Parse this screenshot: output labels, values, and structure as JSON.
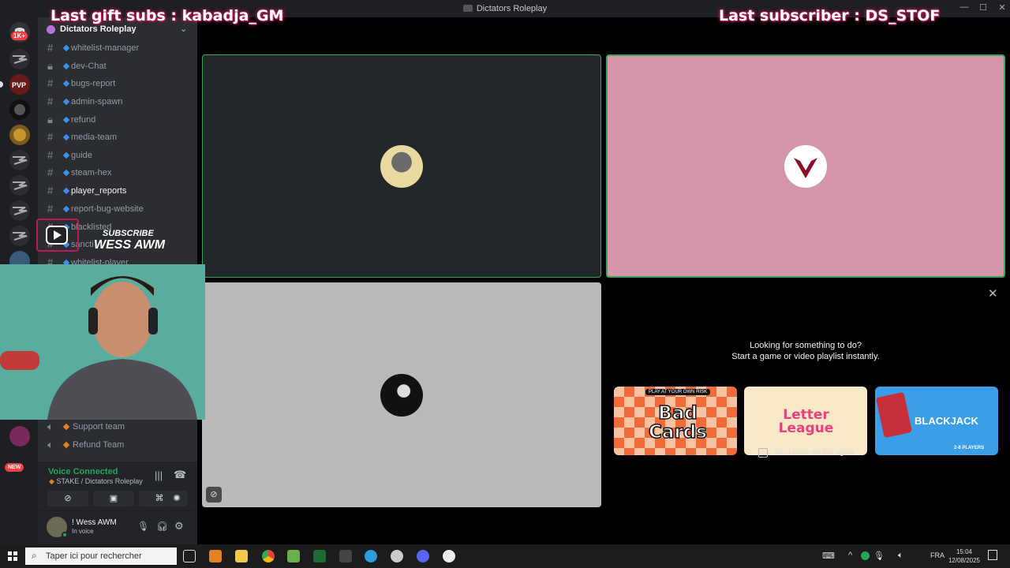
{
  "window": {
    "title": "Dictators Roleplay"
  },
  "overlay": {
    "left_text": "Last gift subs : kabadja_GM",
    "right_text": "Last subscriber : DS_STOF",
    "subscribe_label": "SUBSCRIBE",
    "channel_name": "WESS AWM"
  },
  "rail": {
    "badge": "1K+",
    "new_badge": "NEW"
  },
  "server": {
    "name": "Dictators Roleplay"
  },
  "channels": [
    {
      "name": "whitelist-manager",
      "icon": "hash"
    },
    {
      "name": "dev-Chat",
      "icon": "lock"
    },
    {
      "name": "bugs-report",
      "icon": "hash"
    },
    {
      "name": "admin-spawn",
      "icon": "hash"
    },
    {
      "name": "refund",
      "icon": "lock"
    },
    {
      "name": "media-team",
      "icon": "hash"
    },
    {
      "name": "guide",
      "icon": "hash"
    },
    {
      "name": "steam-hex",
      "icon": "hash"
    },
    {
      "name": "player_reports",
      "icon": "hash"
    },
    {
      "name": "report-bug-website",
      "icon": "hash"
    },
    {
      "name": "blacklisted",
      "icon": "hash"
    },
    {
      "name": "sancti",
      "icon": "hash"
    },
    {
      "name": "whitelist-player",
      "icon": "hash"
    }
  ],
  "voice_channels": [
    {
      "name": "Support team"
    },
    {
      "name": "Refund Team"
    }
  ],
  "voice": {
    "status": "Voice Connected",
    "location": "STAKE / Dictators Roleplay"
  },
  "user": {
    "name": "! Wess AWM",
    "status": "In voice"
  },
  "activity": {
    "line1": "Looking for something to do?",
    "line2": "Start a game or video playlist instantly.",
    "dont_show": "Don't show me this again.",
    "cards": [
      {
        "title": "Bad Cards",
        "tag": "PLAY AT YOUR OWN RISK"
      },
      {
        "title": "Letter League",
        "tag": ""
      },
      {
        "title": "BLACKJACK",
        "tag": "2-8 PLAYERS"
      }
    ]
  },
  "taskbar": {
    "search_placeholder": "Taper ici pour rechercher",
    "lang": "FRA",
    "time": "15:04",
    "date": "12/08/2025"
  },
  "colors": {
    "tile_dark": "#23272a",
    "tile_pink": "#d496a8",
    "tile_grey": "#b9b9b9",
    "speaking": "#3ba55d",
    "accent": "#3b8eea",
    "overlay_glow": "#c0185d"
  }
}
